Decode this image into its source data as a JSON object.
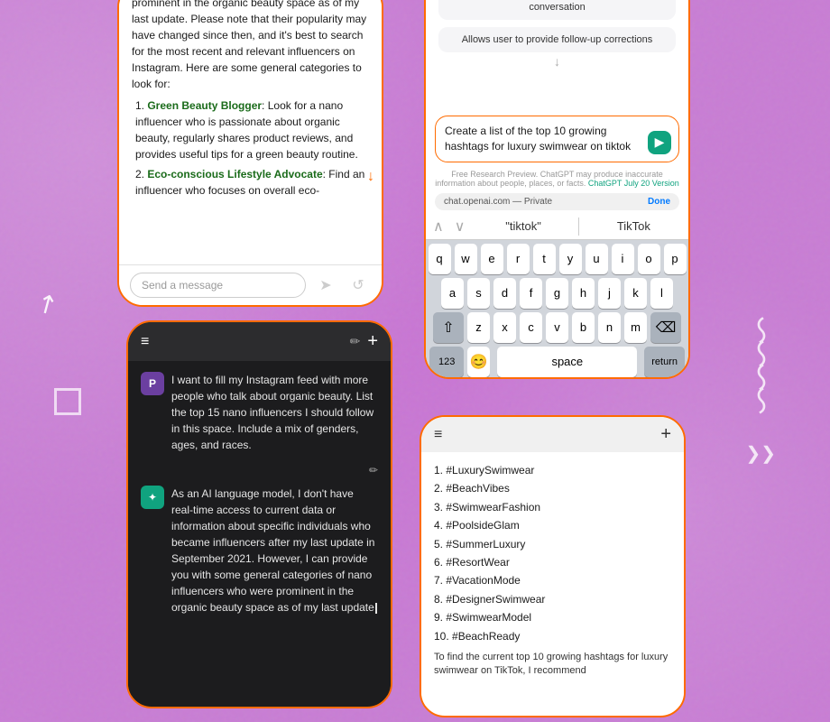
{
  "background": {
    "color": "#c87dd4"
  },
  "card1": {
    "type": "chat-light",
    "content": "prominent in the organic beauty space as of my last update. Please note that their popularity may have changed since then, and it's best to search for the most recent and relevant influencers on Instagram. Here are some general categories to look for:",
    "list": [
      {
        "number": 1,
        "term": "Green Beauty Blogger",
        "desc": "Look for a nano influencer who is passionate about organic beauty, regularly shares product reviews, and provides useful tips for a green beauty routine."
      },
      {
        "number": 2,
        "term": "Eco-conscious Lifestyle Advocate",
        "desc": "Find an influencer who focuses on overall eco-"
      }
    ],
    "input_placeholder": "Send a message"
  },
  "card2": {
    "type": "chat-dark",
    "user_message": "I want to fill my Instagram feed with more people who talk about organic beauty. List the top 15 nano influencers I should follow in this space. Include a mix of genders, ages, and races.",
    "ai_response": "As an AI language model, I don't have real-time access to current data or information about specific individuals who became influencers after my last update in September 2021. However, I can provide you with some general categories of nano influencers who were prominent in the organic beauty space as of my last update",
    "header_left": "≡",
    "header_right": "+"
  },
  "card3": {
    "type": "chatgpt-keyboard",
    "capabilities": [
      "Remembers what user said earlier in the conversation",
      "Allows user to provide follow-up corrections"
    ],
    "scroll_icon": "↓",
    "input_text": "Create a list of the top 10 growing hashtags for luxury swimwear on tiktok",
    "disclaimer": "Free Research Preview. ChatGPT may produce inaccurate information about people, places, or facts.",
    "disclaimer_link": "ChatGPT July 20 Version",
    "url": "chat.openai.com — Private",
    "url_action": "Done",
    "suggestions": [
      "\"tiktok\"",
      "TikTok"
    ],
    "keyboard_rows": [
      [
        "q",
        "w",
        "e",
        "r",
        "t",
        "y",
        "u",
        "i",
        "o",
        "p"
      ],
      [
        "a",
        "s",
        "d",
        "f",
        "g",
        "h",
        "j",
        "k",
        "l"
      ],
      [
        "z",
        "x",
        "c",
        "v",
        "b",
        "n",
        "m"
      ],
      [
        "123",
        "😊",
        "space",
        "return"
      ]
    ]
  },
  "card4": {
    "type": "hashtags",
    "header_left": "≡",
    "header_right": "+",
    "hashtags": [
      "#LuxurySwimwear",
      "#BeachVibes",
      "#SwimwearFashion",
      "#PoolsideGlam",
      "#SummerLuxury",
      "#ResortWear",
      "#VacationMode",
      "#DesignerSwimwear",
      "#SwimwearModel",
      "#BeachReady"
    ],
    "footer": "To find the current top 10 growing hashtags for luxury swimwear on TikTok, I recommend"
  }
}
